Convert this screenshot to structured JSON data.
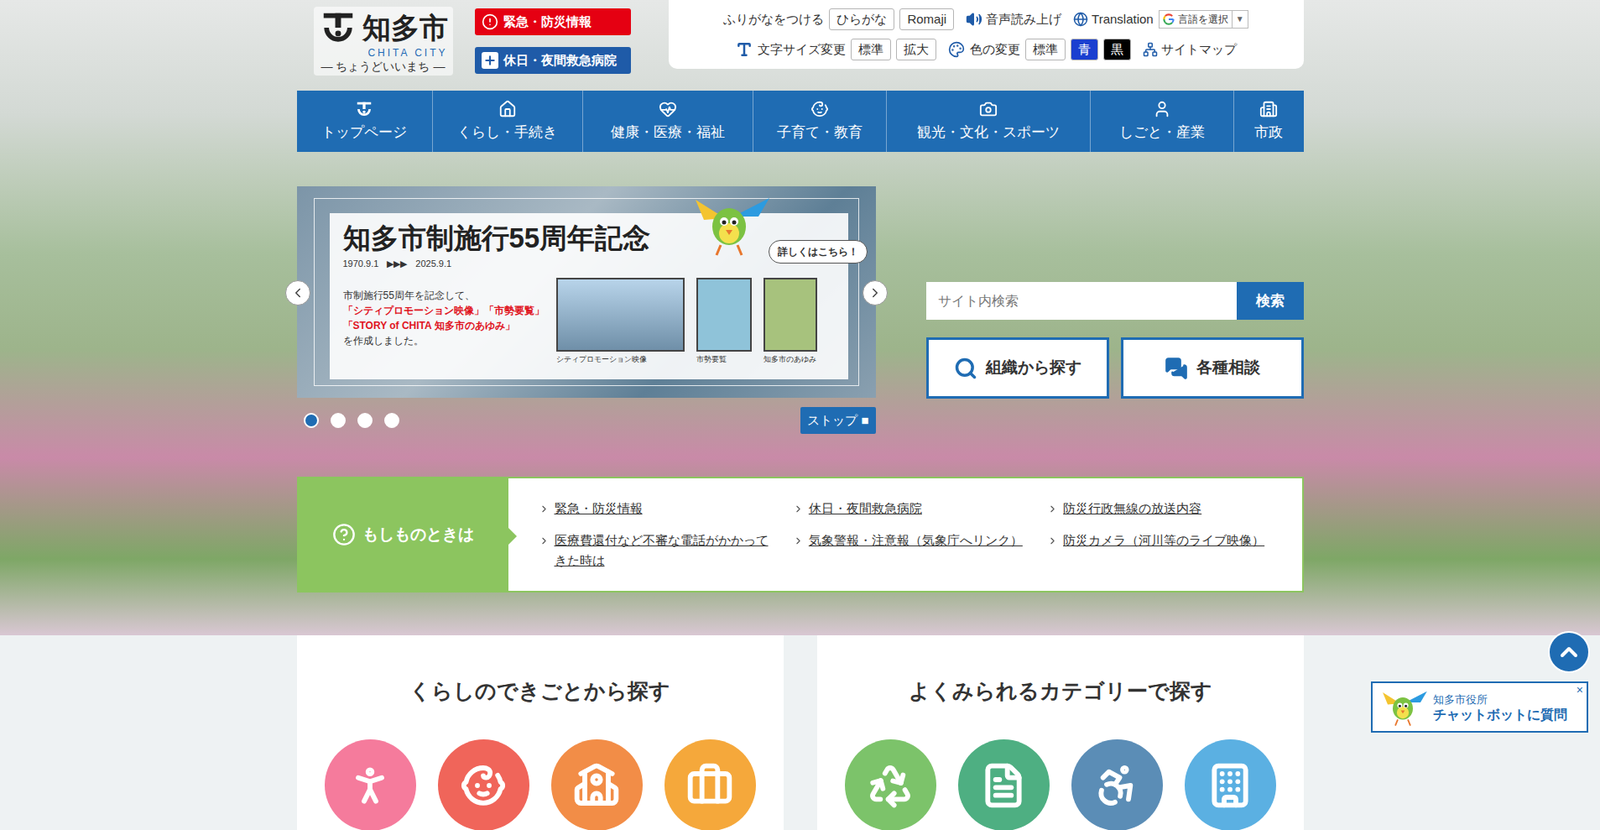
{
  "header": {
    "logo": {
      "name": "知多市",
      "romaji": "CHITA CITY",
      "tagline": "— ちょうどいいまち —"
    },
    "alert_buttons": [
      {
        "label": "緊急・防災情報",
        "color": "#e50012"
      },
      {
        "label": "休日・夜間救急病院",
        "color": "#1f5ba8"
      }
    ],
    "tools": {
      "furigana": {
        "label": "ふりがなをつける",
        "options": [
          "ひらがな",
          "Romaji"
        ]
      },
      "voice": "音声読み上げ",
      "translation": {
        "label": "Translation",
        "select": "言語を選択",
        "arrow": "▼"
      },
      "font_size": {
        "label": "文字サイズ変更",
        "options": [
          "標準",
          "拡大"
        ]
      },
      "colors": {
        "label": "色の変更",
        "options": [
          {
            "label": "標準",
            "color": "#ffffff",
            "text_color": "#333333"
          },
          {
            "label": "青",
            "color": "#1a3fd0",
            "text_color": "#ffffff"
          },
          {
            "label": "黒",
            "color": "#000000",
            "text_color": "#ffffff"
          }
        ]
      },
      "sitemap": "サイトマップ"
    }
  },
  "nav": [
    {
      "label": "トップページ"
    },
    {
      "label": "くらし・手続き"
    },
    {
      "label": "健康・医療・福祉"
    },
    {
      "label": "子育て・教育"
    },
    {
      "label": "観光・文化・スポーツ"
    },
    {
      "label": "しごと・産業"
    },
    {
      "label": "市政"
    }
  ],
  "carousel": {
    "title": "知多市制施行55周年記念",
    "start": "1970.9.1",
    "arrows": "▶▶▶",
    "end": "2025.9.1",
    "lines": [
      {
        "text": "市制施行55周年を記念して、",
        "highlight": false
      },
      {
        "text": "「シティプロモーション映像」「市勢要覧」",
        "highlight": true
      },
      {
        "text": "「STORY of CHITA 知多市のあゆみ」",
        "highlight": true
      },
      {
        "text": "を作成しました。",
        "highlight": false
      }
    ],
    "bubble": "詳しくはこちら！",
    "thumbnails": [
      {
        "caption": "シティプロモーション映像"
      },
      {
        "caption": "市勢要覧"
      },
      {
        "caption": "知多市のあゆみ"
      }
    ],
    "dots": [
      {
        "selected": true
      },
      {
        "selected": false
      },
      {
        "selected": false
      },
      {
        "selected": false
      }
    ],
    "stop": {
      "label": "ストップ",
      "icon": "■"
    }
  },
  "search": {
    "placeholder": "サイト内検索",
    "button": "検索"
  },
  "shortcuts": [
    {
      "label": "組織から探す"
    },
    {
      "label": "各種相談"
    }
  ],
  "emergency": {
    "title": "もしものときは",
    "links": [
      "緊急・防災情報",
      "休日・夜間救急病院",
      "防災行政無線の放送内容",
      "医療費還付など不審な電話がかかってきた時は",
      "気象警報・注意報（気象庁へリンク）",
      "防災カメラ（河川等のライブ映像）"
    ]
  },
  "finders": [
    {
      "title": "くらしのできごとから探す",
      "items": [
        {
          "color": "#f57b9c"
        },
        {
          "color": "#f0655a"
        },
        {
          "color": "#f28d47"
        },
        {
          "color": "#f5a83b"
        }
      ]
    },
    {
      "title": "よくみられるカテゴリーで探す",
      "items": [
        {
          "color": "#7cc36a"
        },
        {
          "color": "#4eaf82"
        },
        {
          "color": "#5b8db6"
        },
        {
          "color": "#5bb0e2"
        }
      ]
    }
  ],
  "chatbot": {
    "line1": "知多市役所",
    "line2": "チャットボットに質問",
    "close": "×"
  }
}
